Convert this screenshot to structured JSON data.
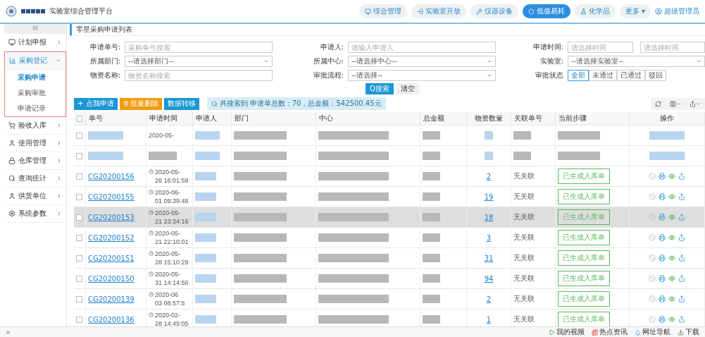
{
  "header": {
    "platform_title": "实验室综合管理平台",
    "nav": [
      {
        "label": "综合管理",
        "selected": false
      },
      {
        "label": "实验室开放",
        "selected": false
      },
      {
        "label": "仪器设备",
        "selected": false
      },
      {
        "label": "低值易耗",
        "selected": true
      },
      {
        "label": "化学品",
        "selected": false
      },
      {
        "label": "更多 ▾",
        "selected": false
      }
    ],
    "user": "超级管理员"
  },
  "sidebar": {
    "toggle": "III",
    "items": [
      {
        "label": "计划申报",
        "expanded": false
      },
      {
        "label": "采购登记",
        "expanded": true,
        "children": [
          {
            "label": "采购申请",
            "selected": true
          },
          {
            "label": "采购审批",
            "selected": false
          },
          {
            "label": "申请记录",
            "selected": false
          }
        ]
      },
      {
        "label": "验收入库",
        "expanded": false
      },
      {
        "label": "使用管理",
        "expanded": false
      },
      {
        "label": "仓库管理",
        "expanded": false
      },
      {
        "label": "查询统计",
        "expanded": false
      },
      {
        "label": "供货单位",
        "expanded": false
      },
      {
        "label": "系统参数",
        "expanded": false
      }
    ]
  },
  "page_title": "零星采购申请列表",
  "filters": [
    {
      "label": "申请单号:",
      "kind": "text",
      "placeholder": "采购单号搜索"
    },
    {
      "label": "申请人:",
      "kind": "text",
      "placeholder": "请输入申请人"
    },
    {
      "label": "申请时间:",
      "kind": "range",
      "placeholder": "请选择时间",
      "placeholder_end": "请选择时间"
    },
    {
      "label": "所属部门:",
      "kind": "select",
      "value": "--请选择部门--"
    },
    {
      "label": "所属中心:",
      "kind": "select",
      "value": "--请选择中心--"
    },
    {
      "label": "实验室:",
      "kind": "select",
      "value": "--请选择实验室--"
    },
    {
      "label": "物资名称:",
      "kind": "text",
      "placeholder": "物资名称搜索"
    },
    {
      "label": "审批流程:",
      "kind": "select",
      "value": "--请选择--"
    },
    {
      "label": "审批状态",
      "kind": "segments",
      "options": [
        {
          "label": "全部",
          "selected": true
        },
        {
          "label": "未通过",
          "selected": false
        },
        {
          "label": "已通过",
          "selected": false
        },
        {
          "label": "驳回",
          "selected": false
        }
      ]
    }
  ],
  "search_button": "Q搜索",
  "clear_button": "清空",
  "actions": [
    {
      "label": "+ 点我申请",
      "kind": "primary"
    },
    {
      "label": "批量删除",
      "kind": "danger"
    },
    {
      "label": "数据转移",
      "kind": "primary"
    }
  ],
  "summary": "共搜索到 申请单总数：70，总金额：542500.45元",
  "table": {
    "all_checked": false,
    "columns": [
      "单号",
      "申请时间",
      "申请人",
      "部门",
      "中心",
      "总金额",
      "物资数量",
      "关联单号",
      "当前步骤",
      "操作"
    ],
    "rows": [
      {
        "kind": "redacted",
        "hovered": false,
        "time_line1": "2020-05-"
      },
      {
        "kind": "redacted",
        "hovered": false
      },
      {
        "kind": "record",
        "hovered": false,
        "id": "CG20200156",
        "time_line1": "2020-05-",
        "time_line2": "26 16:01:59",
        "quantity": "2",
        "related": "无关联",
        "step": "已生成入库单"
      },
      {
        "kind": "record",
        "hovered": false,
        "id": "CG20200155",
        "time_line1": "2020-06-",
        "time_line2": "01 09:39:48",
        "quantity": "19",
        "related": "无关联",
        "step": "已生成入库单"
      },
      {
        "kind": "record",
        "hovered": true,
        "id": "CG20200153",
        "time_line1": "2020-05-",
        "time_line2": "21 23:34:16",
        "quantity": "18",
        "related": "无关联",
        "step": "已生成入库单"
      },
      {
        "kind": "record",
        "hovered": false,
        "id": "CG20200152",
        "time_line1": "2020-05-",
        "time_line2": "21 22:10:01",
        "quantity": "3",
        "related": "无关联",
        "step": "已生成入库单"
      },
      {
        "kind": "record",
        "hovered": false,
        "id": "CG20200151",
        "time_line1": "2020-05-",
        "time_line2": "28 15:10:29",
        "quantity": "31",
        "related": "无关联",
        "step": "已生成入库单"
      },
      {
        "kind": "record",
        "hovered": false,
        "id": "CG20200150",
        "time_line1": "2020-05-",
        "time_line2": "31 14:14:56",
        "quantity": "94",
        "related": "无关联",
        "step": "已生成入库单"
      },
      {
        "kind": "record",
        "hovered": false,
        "id": "CG20200139",
        "time_line1": "2020-06",
        "time_line2": "03 08:57:5",
        "quantity": "2",
        "related": "无关联",
        "step": "已生成入库单"
      },
      {
        "kind": "record",
        "hovered": false,
        "id": "CG20200136",
        "time_line1": "2020-02-",
        "time_line2": "28 14:49:05",
        "quantity": "1",
        "related": "无关联",
        "step": "已生成入库单"
      }
    ]
  },
  "bottom_bar": [
    {
      "label": "我的视频"
    },
    {
      "label": "热点资讯"
    },
    {
      "label": "网址导航"
    },
    {
      "label": "下载"
    }
  ]
}
